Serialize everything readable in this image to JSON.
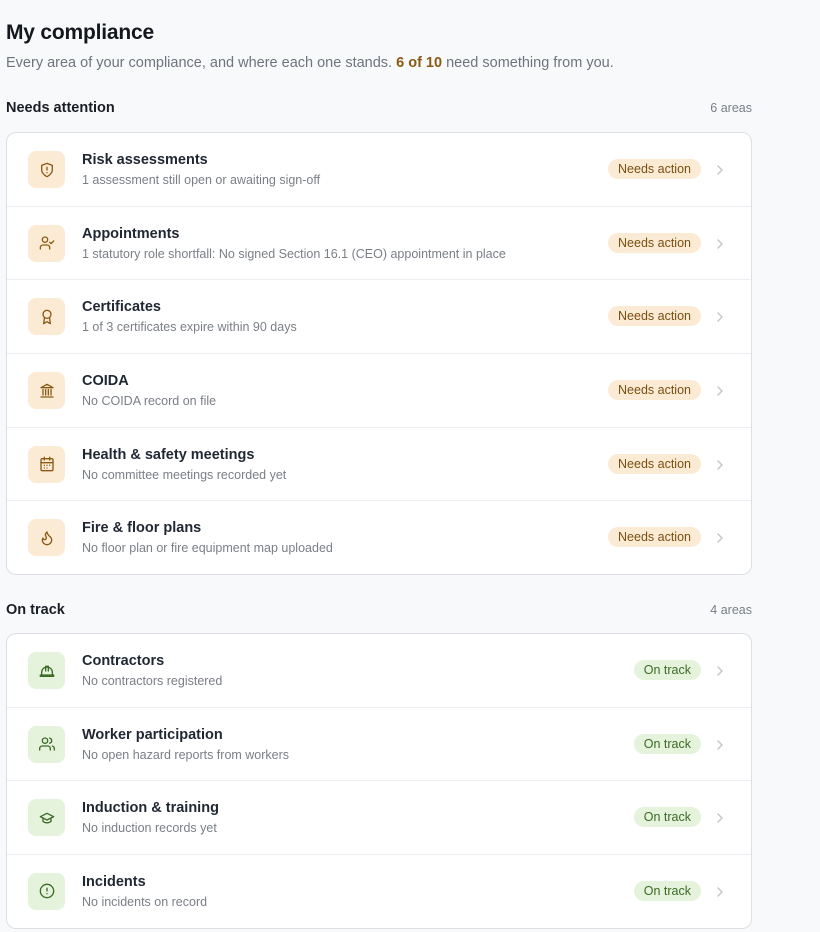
{
  "header": {
    "title": "My compliance",
    "subtitle_pre": "Every area of your compliance, and where each one stands. ",
    "subtitle_highlight": "6 of 10",
    "subtitle_post": " need something from you."
  },
  "sections": {
    "attention": {
      "title": "Needs attention",
      "count": "6 areas",
      "items": [
        {
          "title": "Risk assessments",
          "desc": "1 assessment still open or awaiting sign-off",
          "status": "Needs action",
          "icon": "shield-alert-icon"
        },
        {
          "title": "Appointments",
          "desc": "1 statutory role shortfall: No signed Section 16.1 (CEO) appointment in place",
          "status": "Needs action",
          "icon": "user-check-icon"
        },
        {
          "title": "Certificates",
          "desc": "1 of 3 certificates expire within 90 days",
          "status": "Needs action",
          "icon": "award-icon"
        },
        {
          "title": "COIDA",
          "desc": "No COIDA record on file",
          "status": "Needs action",
          "icon": "bank-icon"
        },
        {
          "title": "Health & safety meetings",
          "desc": "No committee meetings recorded yet",
          "status": "Needs action",
          "icon": "calendar-icon"
        },
        {
          "title": "Fire & floor plans",
          "desc": "No floor plan or fire equipment map uploaded",
          "status": "Needs action",
          "icon": "flame-icon"
        }
      ]
    },
    "ontrack": {
      "title": "On track",
      "count": "4 areas",
      "items": [
        {
          "title": "Contractors",
          "desc": "No contractors registered",
          "status": "On track",
          "icon": "hard-hat-icon"
        },
        {
          "title": "Worker participation",
          "desc": "No open hazard reports from workers",
          "status": "On track",
          "icon": "users-icon"
        },
        {
          "title": "Induction & training",
          "desc": "No induction records yet",
          "status": "On track",
          "icon": "graduation-cap-icon"
        },
        {
          "title": "Incidents",
          "desc": "No incidents on record",
          "status": "On track",
          "icon": "alert-circle-icon"
        }
      ]
    }
  },
  "colors": {
    "warn_bg": "#fbebd5",
    "warn_fg": "#8a5a12",
    "ok_bg": "#e5f2dc",
    "ok_fg": "#3b6b25"
  }
}
